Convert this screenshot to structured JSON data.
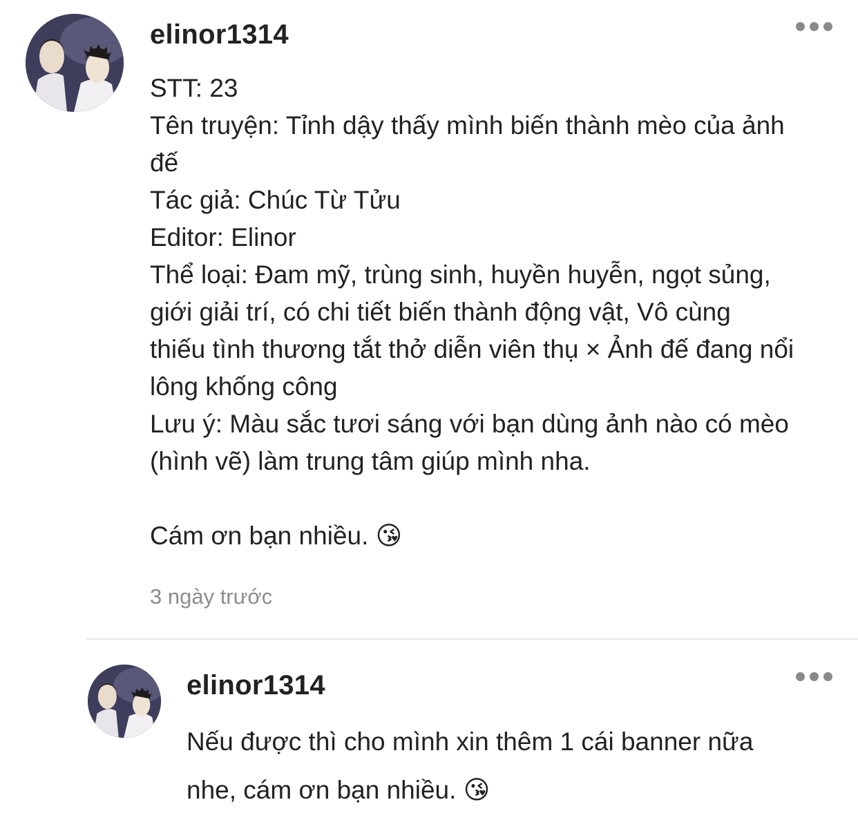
{
  "comments": [
    {
      "username": "elinor1314",
      "body_lines": [
        "STT: 23",
        "Tên truyện: Tỉnh dậy thấy mình biến thành mèo của ảnh",
        "đế",
        "Tác giả: Chúc Từ Tửu",
        "Editor: Elinor",
        "Thể loại: Đam mỹ, trùng sinh, huyền huyễn, ngọt sủng,",
        "giới giải trí, có chi tiết biến thành động vật, Vô cùng",
        "thiếu tình thương tắt thở diễn viên thụ × Ảnh đế đang nổi",
        "lông khống công",
        "Lưu ý: Màu sắc tươi sáng với bạn dùng ảnh nào có mèo",
        "(hình vẽ) làm trung tâm giúp mình nha.",
        "",
        "Cám ơn bạn nhiều. 😘"
      ],
      "timestamp": "3 ngày trước",
      "more_icon": "more-horizontal-icon"
    },
    {
      "username": "elinor1314",
      "body_lines": [
        "Nếu được thì cho mình xin thêm 1 cái banner nữa",
        "nhe, cám ơn bạn nhiều. 😘"
      ],
      "more_icon": "more-horizontal-icon"
    }
  ]
}
